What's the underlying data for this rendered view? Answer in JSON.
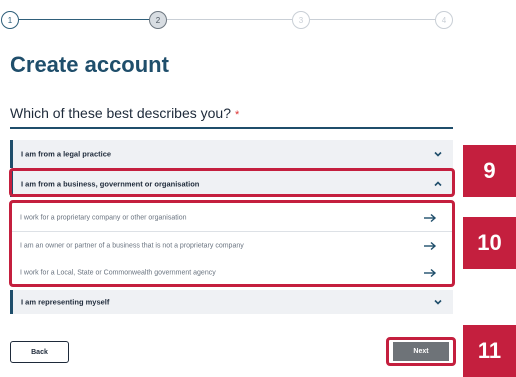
{
  "stepper": {
    "steps": [
      "1",
      "2",
      "3",
      "4"
    ],
    "current": 2
  },
  "page_title": "Create account",
  "question": {
    "text": "Which of these best describes you?",
    "required_mark": "*"
  },
  "accordion": [
    {
      "label": "I am from a legal practice",
      "expanded": false,
      "icon": "chevron-down-icon"
    },
    {
      "label": "I am from a business, government or organisation",
      "expanded": true,
      "icon": "chevron-up-icon",
      "options": [
        "I work for a proprietary company or other organisation",
        "I am an owner or partner of a business that is not a proprietary company",
        "I work for a Local, State or Commonwealth government agency"
      ]
    },
    {
      "label": "I am representing myself",
      "expanded": false,
      "icon": "chevron-down-icon"
    }
  ],
  "annotations": [
    "9",
    "10",
    "11"
  ],
  "buttons": {
    "back": "Back",
    "next": "Next"
  },
  "colors": {
    "brand": "#1f4e6b",
    "highlight": "#c41f3e",
    "next_button": "#6e7378"
  }
}
